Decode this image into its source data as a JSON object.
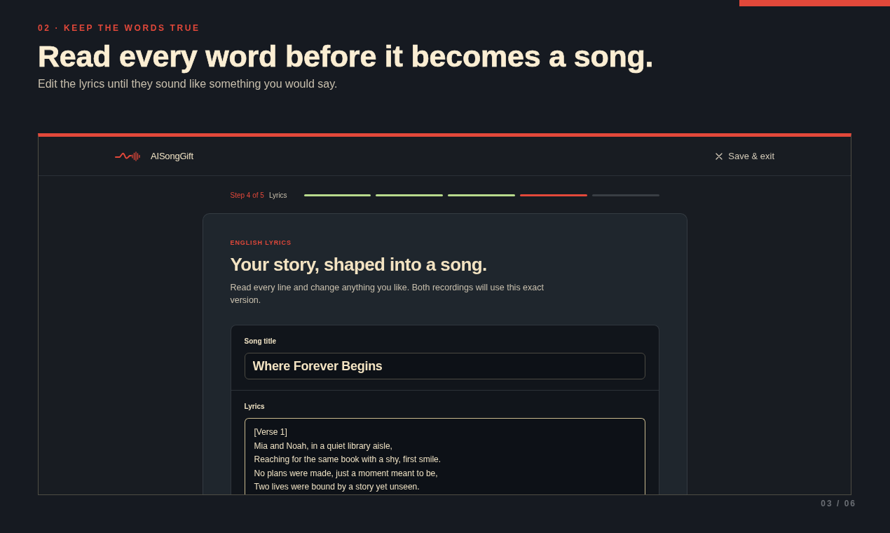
{
  "slide": {
    "eyebrow": "02 · KEEP THE WORDS TRUE",
    "title": "Read every word before it becomes a song.",
    "subtitle": "Edit the lyrics until they sound like something you would say.",
    "page_number": "03 / 06"
  },
  "app": {
    "brand": "AISongGift",
    "exit_button": "Save & exit",
    "progress": {
      "step_label": "Step 4 of 5",
      "step_name": "Lyrics",
      "segments": [
        {
          "kind": "done"
        },
        {
          "kind": "done"
        },
        {
          "kind": "done"
        },
        {
          "kind": "current"
        },
        {
          "kind": "pending"
        }
      ]
    },
    "card": {
      "eyebrow": "ENGLISH LYRICS",
      "title": "Your story, shaped into a song.",
      "description": "Read every line and change anything you like. Both recordings will use this exact version.",
      "fields": [
        {
          "kind": "input",
          "label": "Song title",
          "value": "Where Forever Begins",
          "focused": false
        },
        {
          "kind": "textarea",
          "label": "Lyrics",
          "lines": [
            "[Verse 1]",
            "Mia and Noah, in a quiet library aisle,",
            "Reaching for the same book with a shy, first smile.",
            "No plans were made, just a moment meant to be,",
            "Two lives were bound by a story yet unseen."
          ],
          "focused": true
        }
      ]
    }
  }
}
